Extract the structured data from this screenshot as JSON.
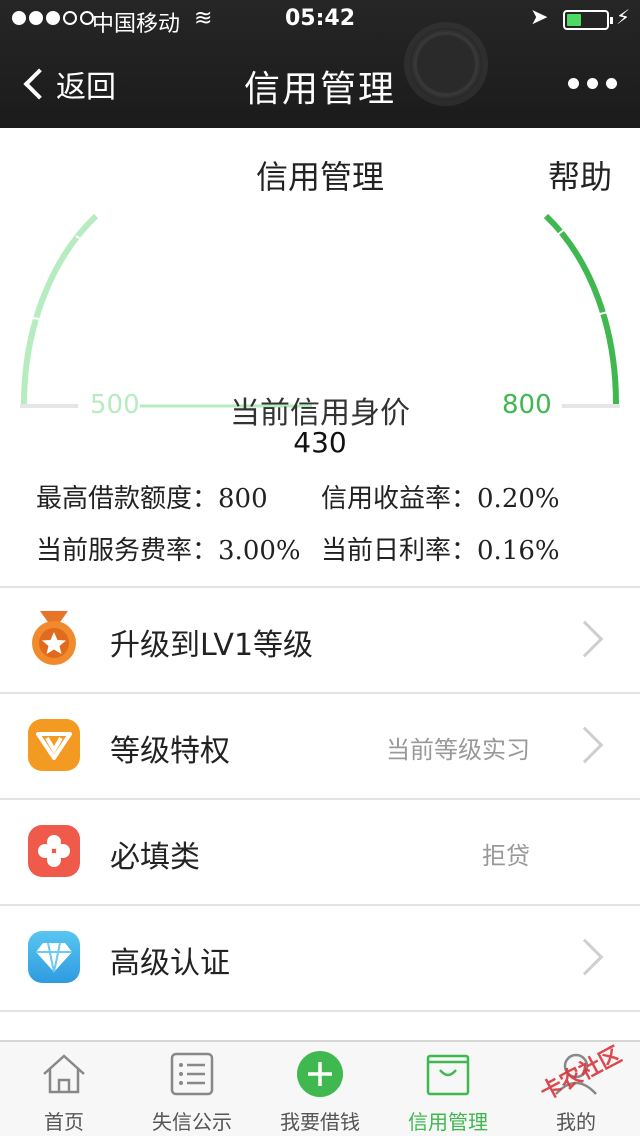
{
  "status_bar": {
    "carrier": "中国移动",
    "time": "05:42",
    "signal_filled": 3,
    "signal_total": 5,
    "battery_level": 0.3
  },
  "nav": {
    "back_label": "返回",
    "title": "信用管理"
  },
  "header": {
    "subtitle": "信用管理",
    "help_label": "帮助"
  },
  "gauge": {
    "min_label": "500",
    "max_label": "800",
    "caption": "当前信用身价",
    "value": "430",
    "colors": {
      "low": "#b6ecc0",
      "high": "#3fb84f",
      "track": "#e6e6e6"
    }
  },
  "stats": [
    {
      "label": "最高借款额度：",
      "value": "800"
    },
    {
      "label": "信用收益率：",
      "value": "0.20%"
    },
    {
      "label": "当前服务费率：",
      "value": "3.00%"
    },
    {
      "label": "当前日利率：",
      "value": "0.16%"
    }
  ],
  "list": [
    {
      "icon": "medal-icon",
      "label": "升级到LV1等级",
      "value": "",
      "arrow": true
    },
    {
      "icon": "v-badge-icon",
      "label": "等级特权",
      "value": "当前等级实习",
      "arrow": true
    },
    {
      "icon": "flower-icon",
      "label": "必填类",
      "value": "拒贷",
      "arrow": false
    },
    {
      "icon": "diamond-icon",
      "label": "高级认证",
      "value": "",
      "arrow": true
    }
  ],
  "tabs": [
    {
      "icon": "home-icon",
      "label": "首页"
    },
    {
      "icon": "list-icon",
      "label": "失信公示"
    },
    {
      "icon": "plus-circle-icon",
      "label": "我要借钱"
    },
    {
      "icon": "shopping-bag-icon",
      "label": "信用管理"
    },
    {
      "icon": "user-icon",
      "label": "我的"
    }
  ],
  "watermark": "卡农社区",
  "accent_color": "#3fb84f"
}
